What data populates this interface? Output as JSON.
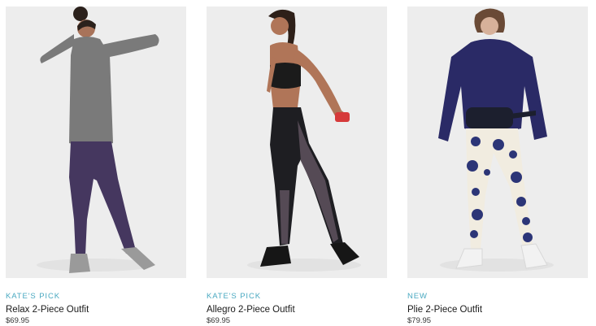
{
  "products": [
    {
      "badge": "KATE'S PICK",
      "name": "Relax 2-Piece Outfit",
      "price": "$69.95",
      "colors": {
        "top": "#7a7a7a",
        "bottoms": "#45375f",
        "shoes": "#9a9a9a",
        "skin": "#a8735a",
        "hair": "#2b211c"
      }
    },
    {
      "badge": "KATE'S PICK",
      "name": "Allegro 2-Piece Outfit",
      "price": "$69.95",
      "colors": {
        "top": "#1b1b1b",
        "bottoms": "#1e1e22",
        "panel": "#554a55",
        "shoes": "#161616",
        "accent": "#d63a3a",
        "skin": "#b07558",
        "hair": "#2e2019"
      }
    },
    {
      "badge": "NEW",
      "name": "Plie 2-Piece Outfit",
      "price": "$79.95",
      "colors": {
        "top": "#2a2a66",
        "bottoms": "#f1ece0",
        "print": "#2c3577",
        "bag": "#1c1f2e",
        "shoes": "#f2f2f2",
        "skin": "#d7b19a",
        "hair": "#6a4a36"
      }
    }
  ]
}
